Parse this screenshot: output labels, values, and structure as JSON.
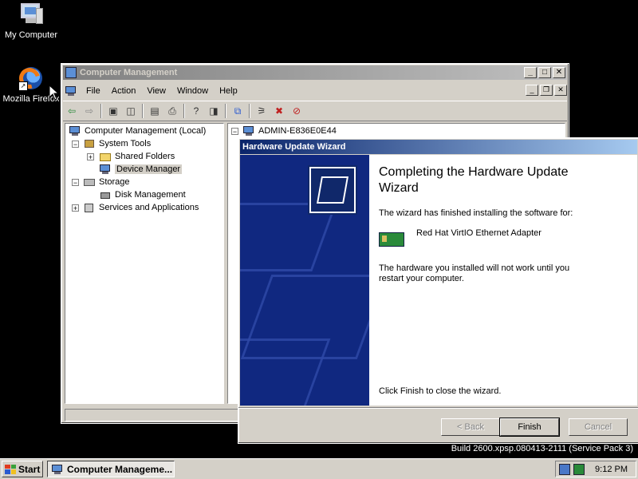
{
  "desktop": {
    "icons": [
      {
        "label": "My Computer",
        "icon": "my-computer-icon"
      },
      {
        "label": "Mozilla Firefox",
        "icon": "firefox-icon"
      }
    ]
  },
  "mmc": {
    "title": "Computer Management",
    "menu": [
      "File",
      "Action",
      "View",
      "Window",
      "Help"
    ],
    "tree": {
      "root": "Computer Management (Local)",
      "system_tools": "System Tools",
      "shared_folders": "Shared Folders",
      "device_manager": "Device Manager",
      "storage": "Storage",
      "disk_management": "Disk Management",
      "services": "Services and Applications"
    },
    "right_pane_root": "ADMIN-E836E0E44"
  },
  "wizard": {
    "title": "Hardware Update Wizard",
    "heading": "Completing the Hardware Update Wizard",
    "line1": "The wizard has finished installing the software for:",
    "device": "Red Hat VirtIO Ethernet Adapter",
    "line2": "The hardware you installed will not work until you restart your computer.",
    "line3": "Click Finish to close the wizard.",
    "buttons": {
      "back": "< Back",
      "finish": "Finish",
      "cancel": "Cancel"
    }
  },
  "build_text": "Build 2600.xpsp.080413-2111 (Service Pack 3)",
  "taskbar": {
    "start": "Start",
    "task": "Computer Manageme...",
    "clock": "9:12 PM"
  }
}
